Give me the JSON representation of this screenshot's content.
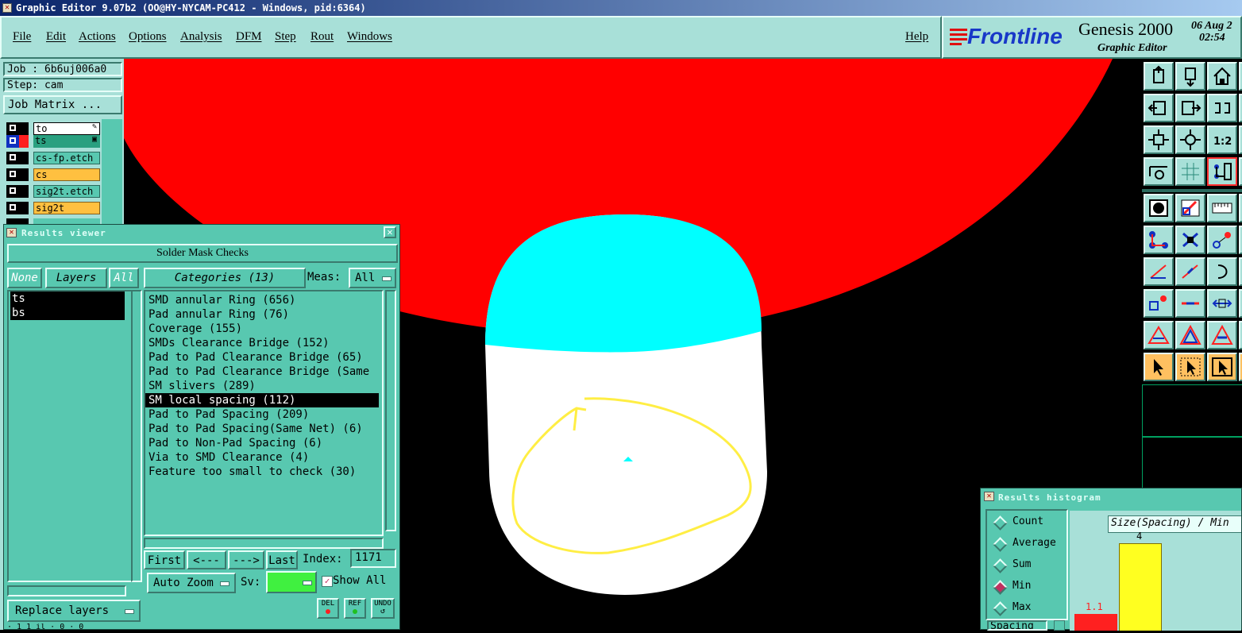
{
  "window": {
    "title": "Graphic Editor 9.07b2 (OO@HY-NYCAM-PC412 - Windows, pid:6364)"
  },
  "menu": {
    "items": [
      "File",
      "Edit",
      "Actions",
      "Options",
      "Analysis",
      "DFM",
      "Step",
      "Rout",
      "Windows"
    ],
    "help": "Help"
  },
  "branding": {
    "company": "Frontline",
    "product": "Genesis 2000",
    "subtitle": "Graphic Editor",
    "date": "06 Aug 2",
    "time": "02:54"
  },
  "job_panel": {
    "job": "Job : 6b6uj006a0",
    "step": "Step: cam",
    "matrix_button": "Job Matrix ...",
    "layers": [
      {
        "name": "to",
        "color": "#ffffff",
        "marker": "✎"
      },
      {
        "name": "ts",
        "color": "#2aa080",
        "marker": "▣"
      },
      {
        "name": "cs-fp.etch",
        "color": "#58c8b0",
        "marker": ""
      },
      {
        "name": "cs",
        "color": "#ffc040",
        "marker": ""
      },
      {
        "name": "sig2t.etch",
        "color": "#58c8b0",
        "marker": ""
      },
      {
        "name": "sig2t",
        "color": "#ffc040",
        "marker": ""
      }
    ],
    "replace_layers": "Replace layers"
  },
  "results_viewer": {
    "title": "Results viewer",
    "header": "Solder Mask Checks",
    "none_btn": "None",
    "layers_btn": "Layers",
    "all_btn": "All",
    "categories_btn": "Categories (13)",
    "meas_label": "Meas:",
    "meas_value": "All",
    "layer_list": [
      "ts",
      "bs"
    ],
    "categories": [
      "SMD annular Ring (656)",
      "Pad annular Ring (76)",
      "Coverage (155)",
      "SMDs Clearance Bridge (152)",
      "Pad to Pad Clearance Bridge (65)",
      "Pad to Pad Clearance Bridge (Same",
      "SM slivers (289)",
      "SM local spacing (112)",
      "Pad to Pad Spacing (209)",
      "Pad to Pad Spacing(Same Net) (6)",
      "Pad to Non-Pad Spacing (6)",
      "Via to SMD Clearance (4)",
      "Feature too small to check (30)"
    ],
    "selected_category": 7,
    "nav": {
      "first": "First",
      "prev": "<---",
      "next": "--->",
      "last": "Last"
    },
    "index_label": "Index:",
    "index_value": "1171",
    "auto_zoom": "Auto Zoom",
    "sv_label": "Sv:",
    "show_all": "Show All",
    "del": "DEL",
    "ref": "REF",
    "undo": "UNDO",
    "status": "· 1 1 il · 0 · 0"
  },
  "results_histogram": {
    "title": "Results histogram",
    "options": [
      "Count",
      "Average",
      "Sum",
      "Min",
      "Max"
    ],
    "selected_option": 3,
    "chart_title": "Size(Spacing) / Min",
    "bar_labels": [
      "1.1",
      "4"
    ],
    "spacing_tab": "Spacing"
  }
}
